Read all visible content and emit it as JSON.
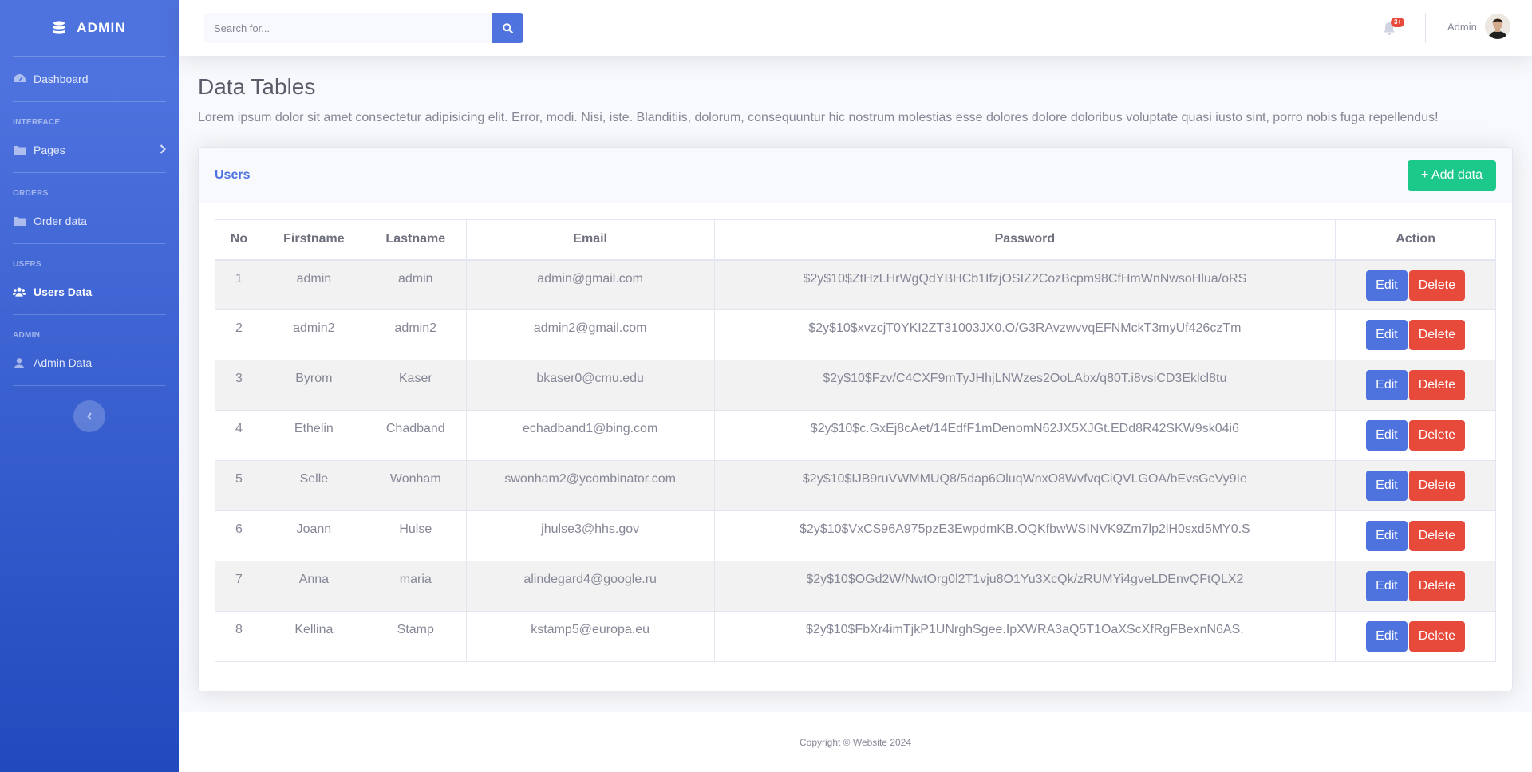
{
  "sidebar": {
    "brand": "ADMIN",
    "items": [
      {
        "label": "Dashboard"
      },
      {
        "heading": "INTERFACE"
      },
      {
        "label": "Pages"
      },
      {
        "heading": "ORDERS"
      },
      {
        "label": "Order data"
      },
      {
        "heading": "USERS"
      },
      {
        "label": "Users Data"
      },
      {
        "heading": "ADMIN"
      },
      {
        "label": "Admin Data"
      }
    ]
  },
  "topbar": {
    "search_placeholder": "Search for...",
    "alerts_badge": "3+",
    "user_name": "Admin"
  },
  "page": {
    "title": "Data Tables",
    "description": "Lorem ipsum dolor sit amet consectetur adipisicing elit. Error, modi. Nisi, iste. Blanditiis, dolorum, consequuntur hic nostrum molestias esse dolores dolore doloribus voluptate quasi iusto sint, porro nobis fuga repellendus!"
  },
  "card": {
    "title": "Users",
    "add_label": "+ Add data"
  },
  "table": {
    "headers": [
      "No",
      "Firstname",
      "Lastname",
      "Email",
      "Password",
      "Action"
    ],
    "edit_label": "Edit",
    "delete_label": "Delete",
    "rows": [
      [
        "1",
        "admin",
        "admin",
        "admin@gmail.com",
        "$2y$10$ZtHzLHrWgQdYBHCb1IfzjOSIZ2CozBcpm98CfHmWnNwsoHlua/oRS"
      ],
      [
        "2",
        "admin2",
        "admin2",
        "admin2@gmail.com",
        "$2y$10$xvzcjT0YKI2ZT31003JX0.O/G3RAvzwvvqEFNMckT3myUf426czTm"
      ],
      [
        "3",
        "Byrom",
        "Kaser",
        "bkaser0@cmu.edu",
        "$2y$10$Fzv/C4CXF9mTyJHhjLNWzes2OoLAbx/q80T.i8vsiCD3Eklcl8tu"
      ],
      [
        "4",
        "Ethelin",
        "Chadband",
        "echadband1@bing.com",
        "$2y$10$c.GxEj8cAet/14EdfF1mDenomN62JX5XJGt.EDd8R42SKW9sk04i6"
      ],
      [
        "5",
        "Selle",
        "Wonham",
        "swonham2@ycombinator.com",
        "$2y$10$IJB9ruVWMMUQ8/5dap6OluqWnxO8WvfvqCiQVLGOA/bEvsGcVy9Ie"
      ],
      [
        "6",
        "Joann",
        "Hulse",
        "jhulse3@hhs.gov",
        "$2y$10$VxCS96A975pzE3EwpdmKB.OQKfbwWSINVK9Zm7lp2lH0sxd5MY0.S"
      ],
      [
        "7",
        "Anna",
        "maria",
        "alindegard4@google.ru",
        "$2y$10$OGd2W/NwtOrg0l2T1vju8O1Yu3XcQk/zRUMYi4gveLDEnvQFtQLX2"
      ],
      [
        "8",
        "Kellina",
        "Stamp",
        "kstamp5@europa.eu",
        "$2y$10$FbXr4imTjkP1UNrghSgee.IpXWRA3aQ5T1OaXScXfRgFBexnN6AS."
      ]
    ]
  },
  "footer": {
    "text": "Copyright © Website 2024"
  }
}
